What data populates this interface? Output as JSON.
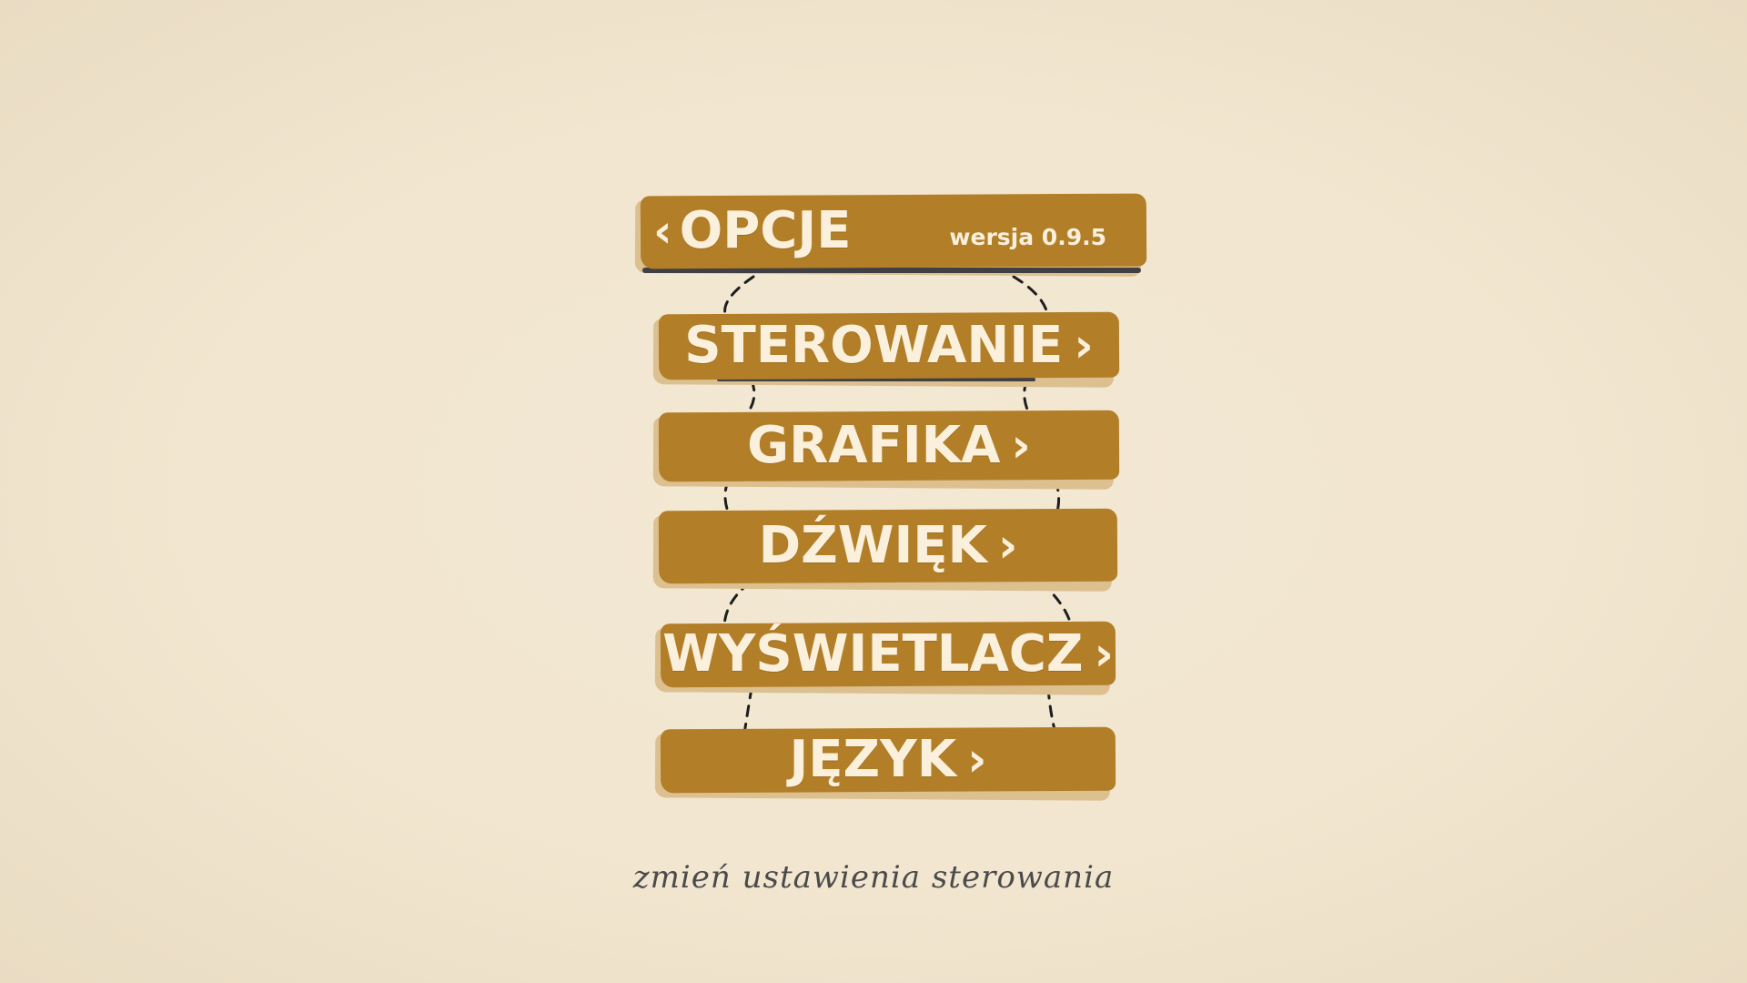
{
  "header": {
    "back_chevron": "‹",
    "title": "OPCJE",
    "version": "wersja 0.9.5"
  },
  "menu": {
    "chevron": "›",
    "items": [
      {
        "label": "STEROWANIE"
      },
      {
        "label": "GRAFIKA"
      },
      {
        "label": "DŹWIĘK"
      },
      {
        "label": "WYŚWIETLACZ"
      },
      {
        "label": "JĘZYK"
      }
    ]
  },
  "hint": "zmień ustawienia sterowania",
  "colors": {
    "background": "#f2e6d0",
    "plank": "#b27f28",
    "plank_shadow": "#dcc08f",
    "plank_text": "#fbf0dc",
    "rope": "#1e1e1e",
    "hint_text": "#4b4b4b"
  }
}
